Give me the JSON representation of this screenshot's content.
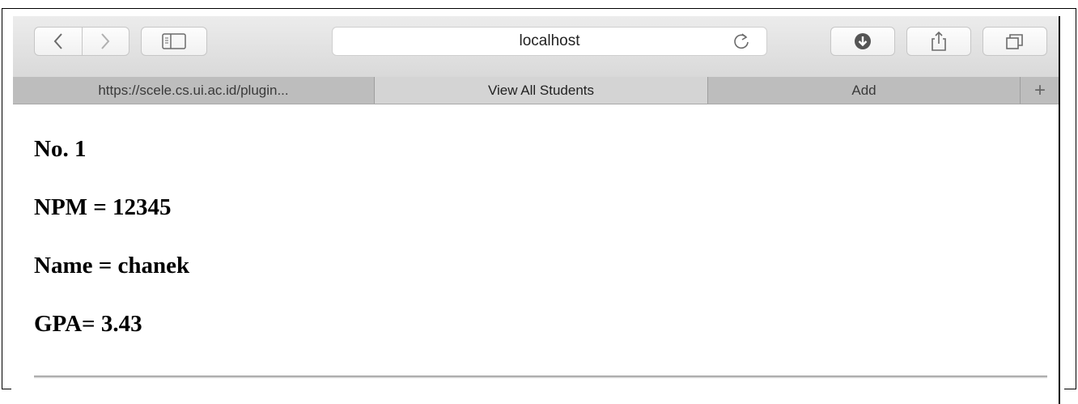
{
  "browser": {
    "address": "localhost",
    "tabs": [
      {
        "label": "https://scele.cs.ui.ac.id/plugin..."
      },
      {
        "label": "View All Students"
      },
      {
        "label": "Add"
      }
    ],
    "new_tab": "+"
  },
  "student": {
    "no": "No. 1",
    "npm": "NPM = 12345",
    "name": "Name = chanek",
    "gpa": "GPA= 3.43"
  }
}
